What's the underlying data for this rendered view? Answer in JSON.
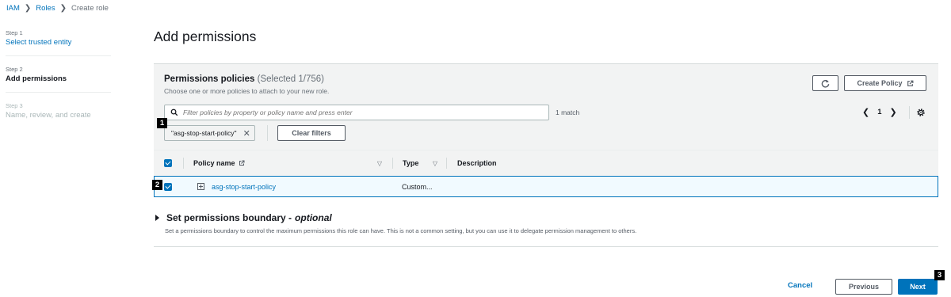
{
  "breadcrumb": {
    "items": [
      "IAM",
      "Roles"
    ],
    "current": "Create role"
  },
  "steps": [
    {
      "number": "Step 1",
      "title": "Select trusted entity"
    },
    {
      "number": "Step 2",
      "title": "Add permissions"
    },
    {
      "number": "Step 3",
      "title": "Name, review, and create"
    }
  ],
  "page_title": "Add permissions",
  "policies": {
    "title": "Permissions policies",
    "selected_count": "(Selected 1/756)",
    "description": "Choose one or more policies to attach to your new role.",
    "create_policy_label": "Create Policy",
    "search_placeholder": "Filter policies by property or policy name and press enter",
    "match_text": "1 match",
    "page_number": "1",
    "filter_token": "\"asg-stop-start-policy\"",
    "clear_filters_label": "Clear filters",
    "columns": {
      "policy_name": "Policy name",
      "type": "Type",
      "description": "Description"
    },
    "rows": [
      {
        "name": "asg-stop-start-policy",
        "type": "Custom...",
        "description": "",
        "selected": true
      }
    ]
  },
  "boundary": {
    "title": "Set permissions boundary -",
    "optional": "optional",
    "description": "Set a permissions boundary to control the maximum permissions this role can have. This is not a common setting, but you can use it to delegate permission management to others."
  },
  "footer": {
    "cancel_label": "Cancel",
    "previous_label": "Previous",
    "next_label": "Next"
  },
  "markers": [
    "1",
    "2",
    "3"
  ],
  "colors": {
    "link": "#0073bb",
    "primary": "#0073bb",
    "panel_bg": "#f2f3f3",
    "selected_row_bg": "#f1faff"
  }
}
